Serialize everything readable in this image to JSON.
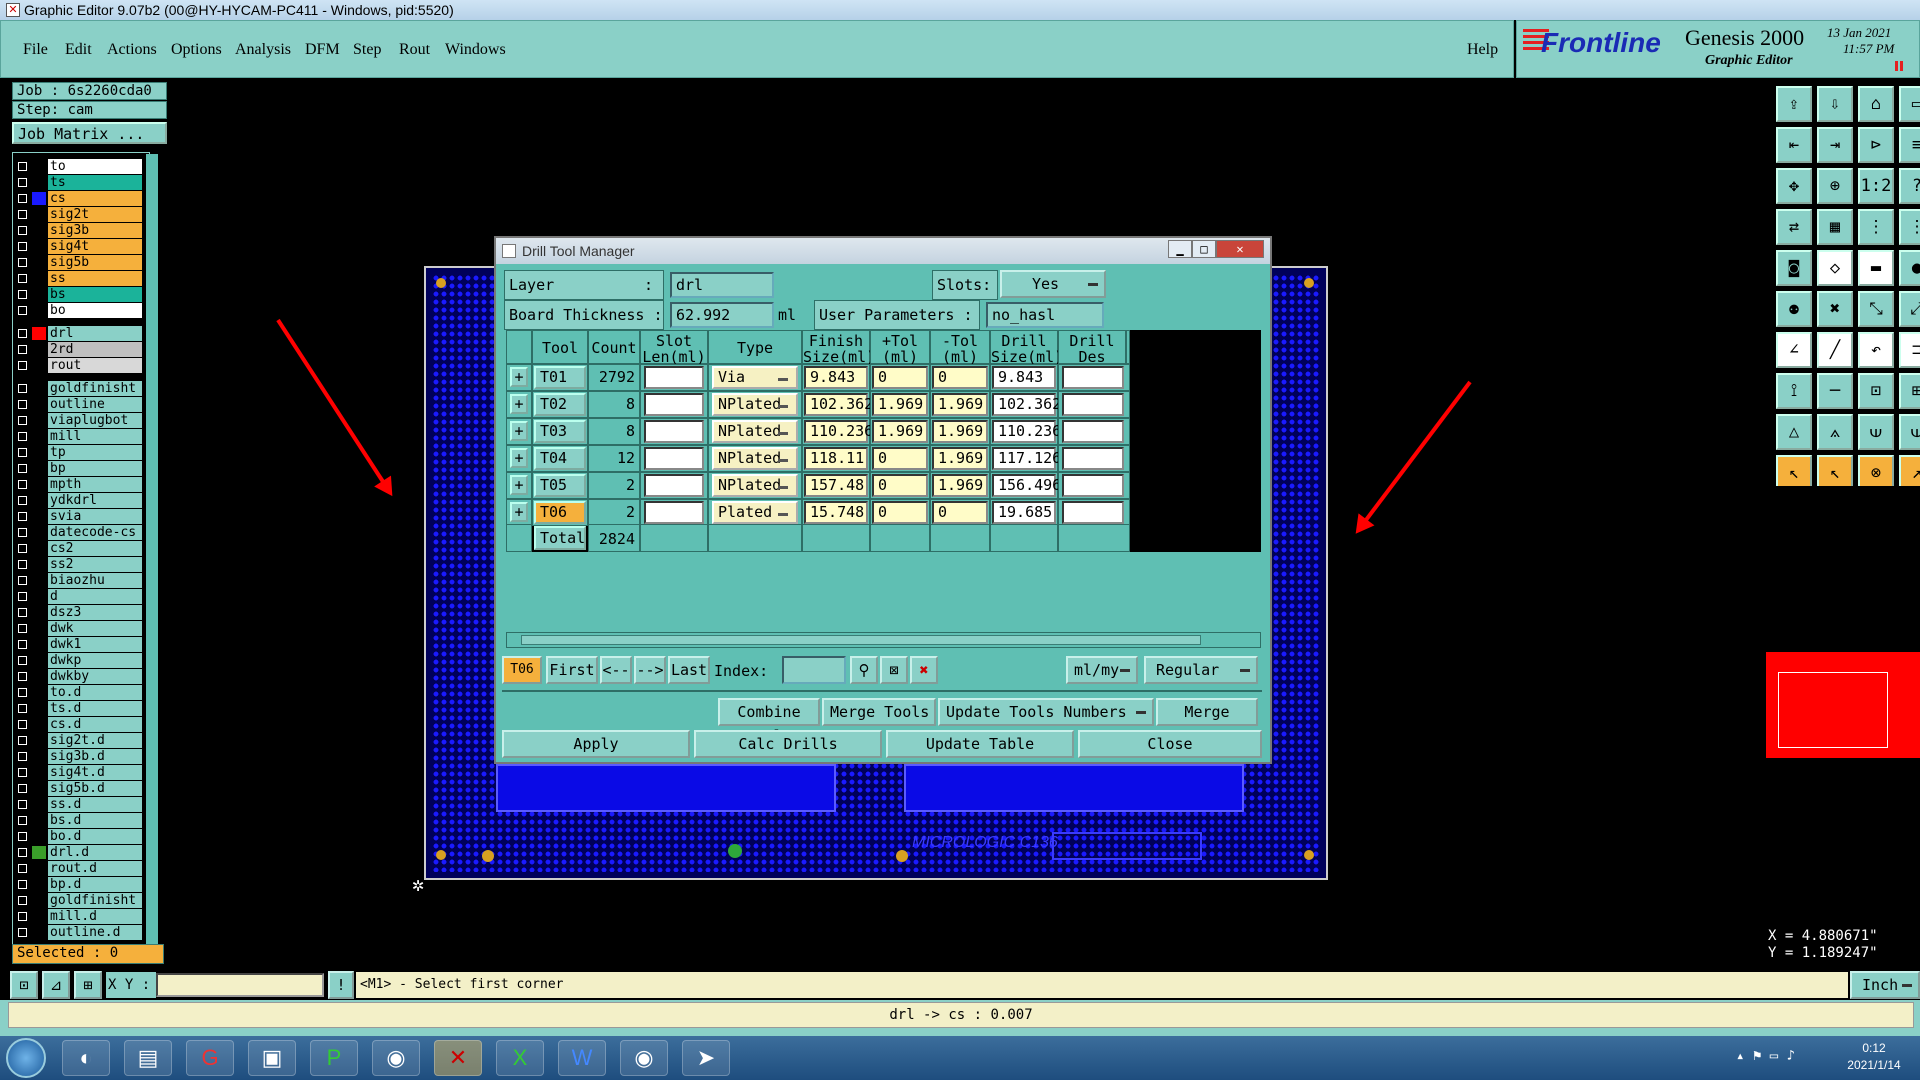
{
  "window": {
    "title": "Graphic Editor 9.07b2 (00@HY-HYCAM-PC411 - Windows, pid:5520)"
  },
  "menu": [
    "File",
    "Edit",
    "Actions",
    "Options",
    "Analysis",
    "DFM",
    "Step",
    "Rout",
    "Windows"
  ],
  "help": "Help",
  "brand": {
    "logo": "Frontline",
    "product": "Genesis 2000",
    "subtitle": "Graphic Editor",
    "date": "13 Jan 2021",
    "time": "11:57 PM"
  },
  "job": {
    "job": "Job : 6s2260cda0",
    "step": "Step: cam",
    "matrix": "Job Matrix ..."
  },
  "layers": [
    {
      "name": "to",
      "color": "#000000",
      "bg": "#ffffff"
    },
    {
      "name": "ts",
      "color": "#000000",
      "bg": "#1bb39a"
    },
    {
      "name": "cs",
      "color": "#1a1aff",
      "bg": "#f5b03c"
    },
    {
      "name": "sig2t",
      "color": "#000000",
      "bg": "#f5b03c"
    },
    {
      "name": "sig3b",
      "color": "#000000",
      "bg": "#f5b03c"
    },
    {
      "name": "sig4t",
      "color": "#000000",
      "bg": "#f5b03c"
    },
    {
      "name": "sig5b",
      "color": "#000000",
      "bg": "#f5b03c"
    },
    {
      "name": "ss",
      "color": "#000000",
      "bg": "#f5b03c"
    },
    {
      "name": "bs",
      "color": "#000000",
      "bg": "#1bb39a"
    },
    {
      "name": "bo",
      "color": "#000000",
      "bg": "#ffffff"
    },
    {
      "name": "drl",
      "color": "#ff0000",
      "bg": "#8ad0c7"
    },
    {
      "name": "2rd",
      "color": "#000000",
      "bg": "#c0c0c0"
    },
    {
      "name": "rout",
      "color": "#000000",
      "bg": "#d8d8d8"
    },
    {
      "name": "goldfinisht",
      "color": "#000000",
      "bg": "#8ad0c7"
    },
    {
      "name": "outline",
      "color": "#000000",
      "bg": "#8ad0c7"
    },
    {
      "name": "viaplugbot",
      "color": "#000000",
      "bg": "#8ad0c7"
    },
    {
      "name": "mill",
      "color": "#000000",
      "bg": "#8ad0c7"
    },
    {
      "name": "tp",
      "color": "#000000",
      "bg": "#8ad0c7"
    },
    {
      "name": "bp",
      "color": "#000000",
      "bg": "#8ad0c7"
    },
    {
      "name": "mpth",
      "color": "#000000",
      "bg": "#8ad0c7"
    },
    {
      "name": "ydkdrl",
      "color": "#000000",
      "bg": "#8ad0c7"
    },
    {
      "name": "svia",
      "color": "#000000",
      "bg": "#8ad0c7"
    },
    {
      "name": "datecode-cs",
      "color": "#000000",
      "bg": "#8ad0c7"
    },
    {
      "name": "cs2",
      "color": "#000000",
      "bg": "#8ad0c7"
    },
    {
      "name": "ss2",
      "color": "#000000",
      "bg": "#8ad0c7"
    },
    {
      "name": "biaozhu",
      "color": "#000000",
      "bg": "#8ad0c7"
    },
    {
      "name": "d",
      "color": "#000000",
      "bg": "#8ad0c7"
    },
    {
      "name": "dsz3",
      "color": "#000000",
      "bg": "#8ad0c7"
    },
    {
      "name": "dwk",
      "color": "#000000",
      "bg": "#8ad0c7"
    },
    {
      "name": "dwk1",
      "color": "#000000",
      "bg": "#8ad0c7"
    },
    {
      "name": "dwkp",
      "color": "#000000",
      "bg": "#8ad0c7"
    },
    {
      "name": "dwkby",
      "color": "#000000",
      "bg": "#8ad0c7"
    },
    {
      "name": "to.d",
      "color": "#000000",
      "bg": "#8ad0c7"
    },
    {
      "name": "ts.d",
      "color": "#000000",
      "bg": "#8ad0c7"
    },
    {
      "name": "cs.d",
      "color": "#000000",
      "bg": "#8ad0c7"
    },
    {
      "name": "sig2t.d",
      "color": "#000000",
      "bg": "#8ad0c7"
    },
    {
      "name": "sig3b.d",
      "color": "#000000",
      "bg": "#8ad0c7"
    },
    {
      "name": "sig4t.d",
      "color": "#000000",
      "bg": "#8ad0c7"
    },
    {
      "name": "sig5b.d",
      "color": "#000000",
      "bg": "#8ad0c7"
    },
    {
      "name": "ss.d",
      "color": "#000000",
      "bg": "#8ad0c7"
    },
    {
      "name": "bs.d",
      "color": "#000000",
      "bg": "#8ad0c7"
    },
    {
      "name": "bo.d",
      "color": "#000000",
      "bg": "#8ad0c7"
    },
    {
      "name": "drl.d",
      "color": "#3a9e2a",
      "bg": "#8ad0c7"
    },
    {
      "name": "rout.d",
      "color": "#000000",
      "bg": "#8ad0c7"
    },
    {
      "name": "bp.d",
      "color": "#000000",
      "bg": "#8ad0c7"
    },
    {
      "name": "goldfinisht",
      "color": "#000000",
      "bg": "#8ad0c7"
    },
    {
      "name": "mill.d",
      "color": "#000000",
      "bg": "#8ad0c7"
    },
    {
      "name": "outline.d",
      "color": "#000000",
      "bg": "#8ad0c7"
    }
  ],
  "selected": "Selected : 0",
  "dialog": {
    "title": "Drill Tool Manager",
    "layer_label": "Layer",
    "layer_value": "drl",
    "slots_label": "Slots:",
    "slots_value": "Yes",
    "thickness_label": "Board Thickness :",
    "thickness_value": "62.992",
    "thickness_unit": "ml",
    "user_params_label": "User Parameters :",
    "user_params_value": "no_hasl",
    "headers": [
      "Tool",
      "Count",
      "Slot\nLen(ml)",
      "Type",
      "Finish\nSize(ml)",
      "+Tol\n(ml)",
      "-Tol\n(ml)",
      "Drill\nSize(ml)",
      "Drill\nDes"
    ],
    "rows": [
      {
        "tool": "T01",
        "count": "2792",
        "type": "Via",
        "finish": "9.843",
        "ptol": "0",
        "ntol": "0",
        "drill": "9.843"
      },
      {
        "tool": "T02",
        "count": "8",
        "type": "NPlated",
        "finish": "102.362",
        "ptol": "1.969",
        "ntol": "1.969",
        "drill": "102.362"
      },
      {
        "tool": "T03",
        "count": "8",
        "type": "NPlated",
        "finish": "110.236",
        "ptol": "1.969",
        "ntol": "1.969",
        "drill": "110.236"
      },
      {
        "tool": "T04",
        "count": "12",
        "type": "NPlated",
        "finish": "118.11",
        "ptol": "0",
        "ntol": "1.969",
        "drill": "117.126"
      },
      {
        "tool": "T05",
        "count": "2",
        "type": "NPlated",
        "finish": "157.48",
        "ptol": "0",
        "ntol": "1.969",
        "drill": "156.496"
      },
      {
        "tool": "T06",
        "count": "2",
        "type": "Plated",
        "finish": "15.748",
        "ptol": "0",
        "ntol": "0",
        "drill": "19.685"
      }
    ],
    "total_label": "Total",
    "total_count": "2824",
    "current_tool": "T06",
    "nav": {
      "first": "First",
      "prev": "<--",
      "next": "-->",
      "last": "Last",
      "index": "Index:"
    },
    "units": "ml/my",
    "mode": "Regular",
    "combine": "Combine Tools",
    "merge_tools": "Merge Tools :",
    "update_numbers": "Update Tools Numbers",
    "merge": "Merge",
    "apply": "Apply",
    "calc": "Calc Drills",
    "update_table": "Update Table",
    "close": "Close"
  },
  "pcb_text": "MICROLOGIC C136",
  "coords": {
    "x": "X = 4.880671\"",
    "y": "Y = 1.189247\""
  },
  "xy_label": "X Y :",
  "prompt": "<M1> - Select first corner",
  "units_btn": "Inch",
  "cmd": "drl -> cs : 0.007",
  "clock": {
    "time": "0:12",
    "date": "2021/1/14"
  },
  "accent": "#8ad0c7",
  "highlight": "#f5b03c"
}
